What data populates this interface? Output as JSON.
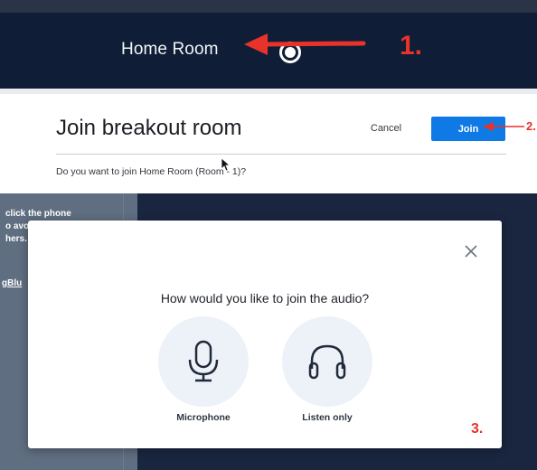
{
  "header": {
    "room_title": "Home Room",
    "annotation": "1."
  },
  "breakout_dialog": {
    "title": "Join breakout room",
    "cancel_label": "Cancel",
    "join_label": "Join",
    "annotation": "2.",
    "question": "Do you want to join Home Room (Room - 1)?"
  },
  "side_panel": {
    "lines": [
      "click the phone",
      "o avo",
      "hers."
    ],
    "link": "gBlu"
  },
  "audio_modal": {
    "question": "How would you like to join the audio?",
    "options": [
      {
        "label": "Microphone",
        "icon": "microphone-icon"
      },
      {
        "label": "Listen only",
        "icon": "headphones-icon"
      }
    ],
    "annotation": "3."
  },
  "colors": {
    "header_bg": "#0f1e36",
    "join_button": "#0f7ae5",
    "annotation_red": "#e8322a",
    "option_circle": "#edf2f8"
  }
}
